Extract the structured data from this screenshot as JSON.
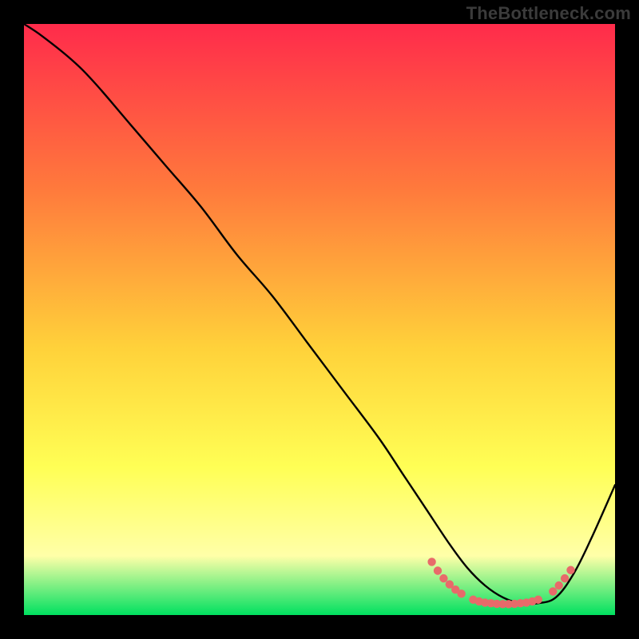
{
  "watermark": "TheBottleneck.com",
  "colors": {
    "background": "#000000",
    "gradient_top": "#ff2b4b",
    "gradient_mid1": "#ff7a3c",
    "gradient_mid2": "#ffd23a",
    "gradient_mid3": "#ffff55",
    "gradient_mid4": "#ffffa8",
    "gradient_bottom": "#00e060",
    "curve": "#000000",
    "dots": "#e86a6a"
  },
  "chart_data": {
    "type": "line",
    "title": "",
    "xlabel": "",
    "ylabel": "",
    "xlim": [
      0,
      100
    ],
    "ylim": [
      0,
      100
    ],
    "series": [
      {
        "name": "black-curve",
        "x": [
          0,
          3,
          8,
          12,
          18,
          24,
          30,
          36,
          42,
          48,
          54,
          60,
          64,
          68,
          72,
          75,
          78,
          81,
          84,
          87,
          90,
          93,
          96,
          100
        ],
        "y": [
          100,
          98,
          94,
          90,
          83,
          76,
          69,
          61,
          54,
          46,
          38,
          30,
          24,
          18,
          12,
          8,
          5,
          3,
          2,
          2,
          3,
          7,
          13,
          22
        ]
      }
    ],
    "dot_cluster": {
      "name": "salmon-dot-band",
      "points": [
        {
          "x": 69,
          "y": 9
        },
        {
          "x": 70,
          "y": 7.5
        },
        {
          "x": 71,
          "y": 6.2
        },
        {
          "x": 72,
          "y": 5.2
        },
        {
          "x": 73,
          "y": 4.3
        },
        {
          "x": 74,
          "y": 3.6
        },
        {
          "x": 76,
          "y": 2.6
        },
        {
          "x": 77,
          "y": 2.3
        },
        {
          "x": 78,
          "y": 2.1
        },
        {
          "x": 79,
          "y": 2.0
        },
        {
          "x": 80,
          "y": 1.9
        },
        {
          "x": 81,
          "y": 1.85
        },
        {
          "x": 82,
          "y": 1.85
        },
        {
          "x": 83,
          "y": 1.9
        },
        {
          "x": 84,
          "y": 2.0
        },
        {
          "x": 85,
          "y": 2.1
        },
        {
          "x": 86,
          "y": 2.3
        },
        {
          "x": 87,
          "y": 2.6
        },
        {
          "x": 89.5,
          "y": 4.0
        },
        {
          "x": 90.5,
          "y": 5.0
        },
        {
          "x": 91.5,
          "y": 6.2
        },
        {
          "x": 92.5,
          "y": 7.6
        }
      ]
    }
  }
}
